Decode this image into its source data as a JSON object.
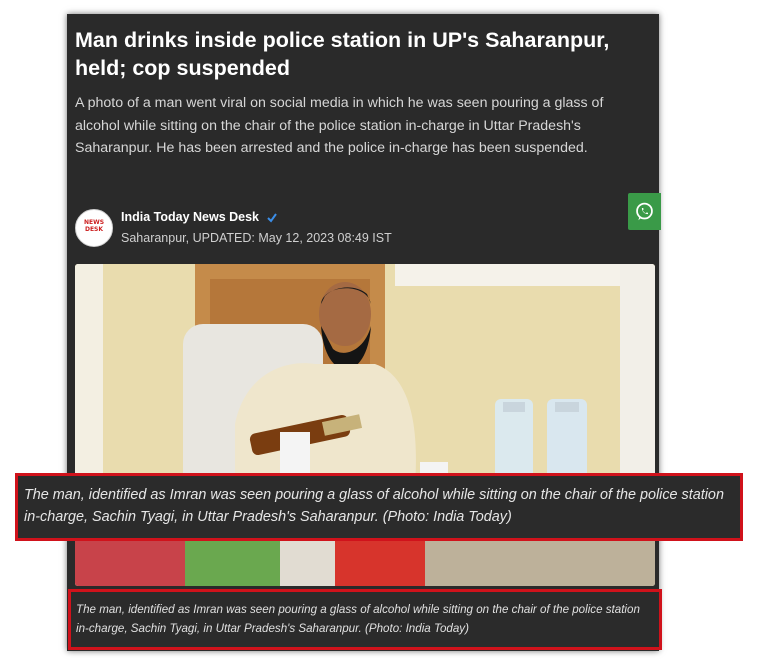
{
  "article": {
    "headline": "Man drinks inside police station in UP's Saharanpur, held; cop suspended",
    "summary": "A photo of a man went viral on social media in which he was seen pouring a glass of alcohol while sitting on the chair of the police station in-charge in Uttar Pradesh's Saharanpur. He has been arrested and the police in-charge has been suspended."
  },
  "byline": {
    "author": "India Today News Desk",
    "location": "Saharanpur,",
    "updated": "UPDATED: May 12, 2023 08:49 IST",
    "avatar_logo": "NEWS DESK",
    "verified_icon": "twitter-verified-icon"
  },
  "share": {
    "icon": "whatsapp-icon",
    "color": "#3a9a48"
  },
  "photo": {
    "description_icon": "article-photo"
  },
  "caption_overlay": "The man, identified as Imran was seen pouring a glass of alcohol while sitting on the chair of the police station in-charge, Sachin Tyagi, in Uttar Pradesh's Saharanpur. (Photo: India Today)",
  "caption_bottom": "The man, identified as Imran was seen pouring a glass of alcohol while sitting on the chair of the police station in-charge, Sachin Tyagi, in Uttar Pradesh's Saharanpur. (Photo: India Today)",
  "colors": {
    "card_background": "#2a2a2a",
    "highlight_border": "#d0121b",
    "whatsapp": "#3a9a48"
  }
}
